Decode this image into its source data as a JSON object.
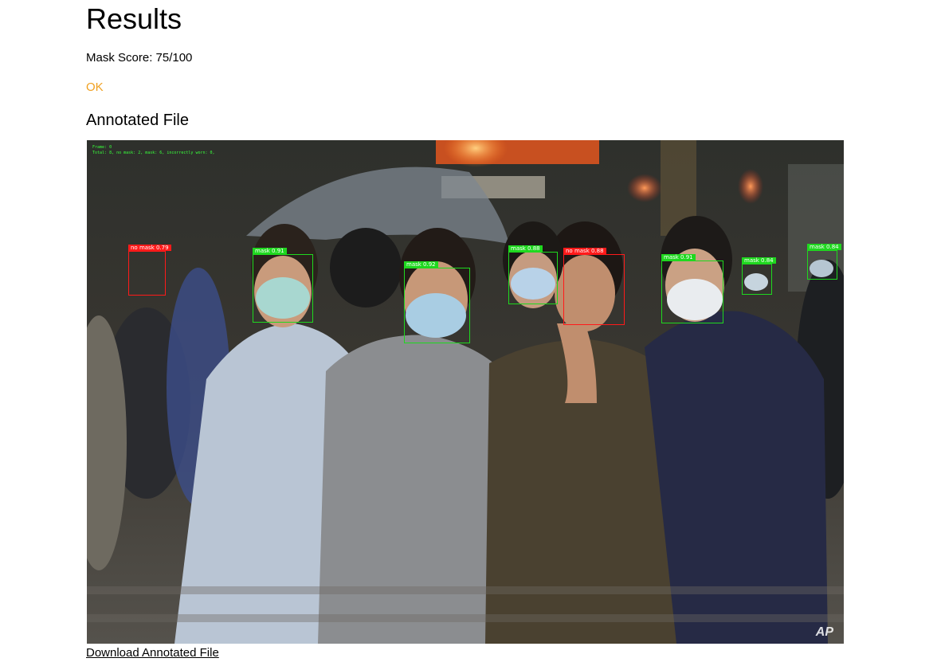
{
  "page": {
    "title": "Results",
    "mask_score": "Mask Score: 75/100",
    "status": "OK",
    "status_color": "#f0a020",
    "section_title": "Annotated File",
    "download_label": "Download Annotated File"
  },
  "annotated_image": {
    "overlay_frame": "Frame: 0",
    "overlay_summary": "Total: 8,   no mask: 2,   mask: 6,   incorrectly worn: 0,",
    "watermark": "AP",
    "colors": {
      "mask": "#1fd81f",
      "no_mask": "#ff1a1a",
      "overlay_text": "#39ff3b"
    },
    "detections": [
      {
        "label": "no mask 0.79",
        "class": "no_mask"
      },
      {
        "label": "mask 0.91",
        "class": "mask"
      },
      {
        "label": "mask 0.92",
        "class": "mask"
      },
      {
        "label": "mask 0.88",
        "class": "mask"
      },
      {
        "label": "no mask 0.88",
        "class": "no_mask"
      },
      {
        "label": "mask 0.91",
        "class": "mask"
      },
      {
        "label": "mask 0.84",
        "class": "mask"
      },
      {
        "label": "mask 0.84",
        "class": "mask"
      }
    ]
  }
}
